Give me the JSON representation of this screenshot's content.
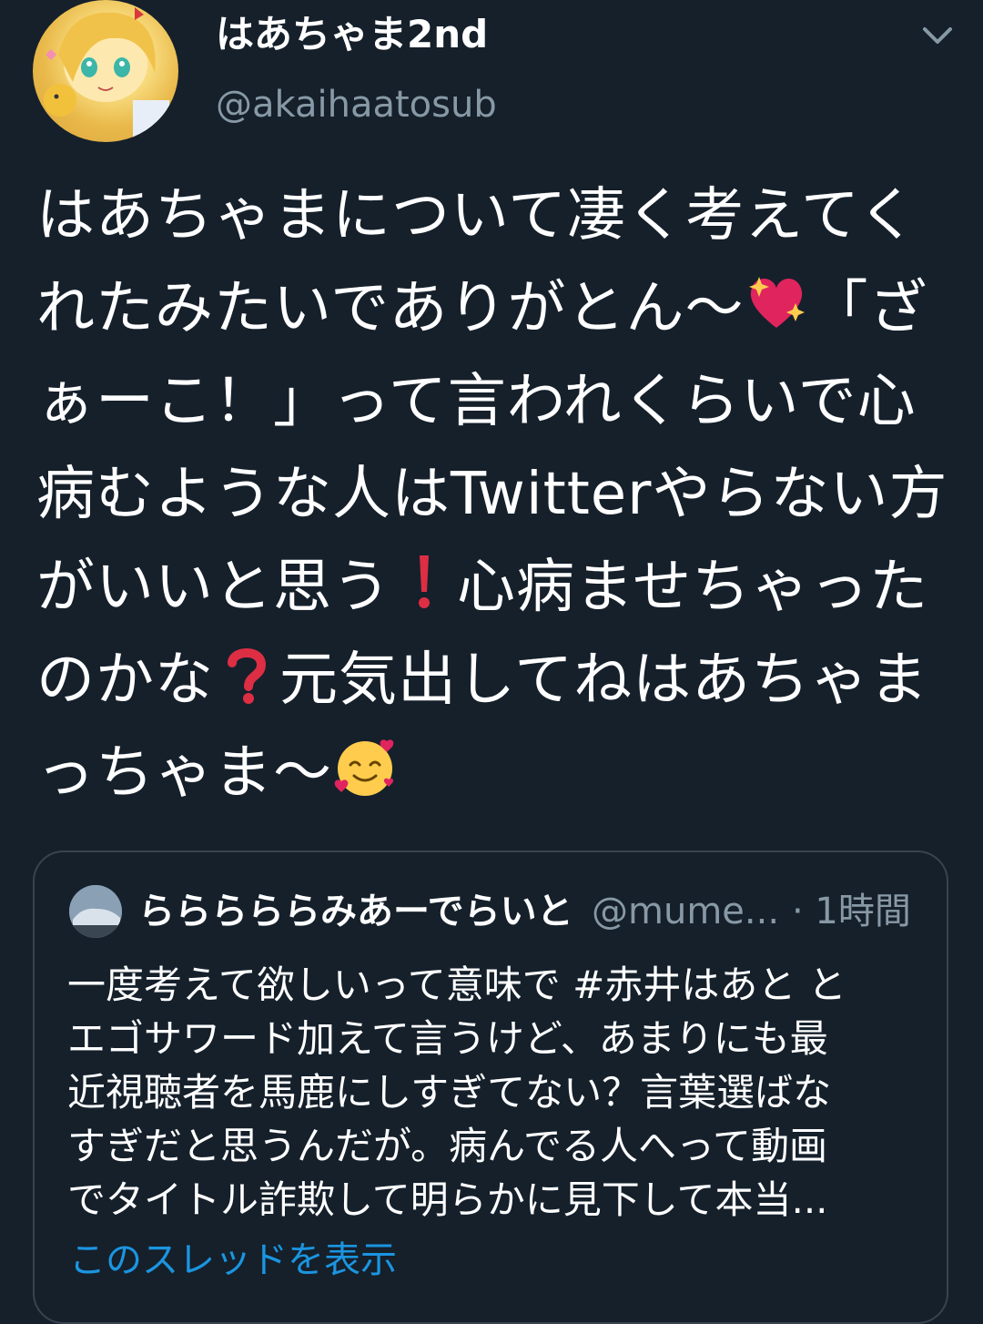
{
  "author": {
    "display_name": "はあちゃま2nd",
    "handle": "@akaihaatosub",
    "avatar_icon": "user-avatar-image"
  },
  "menu_icon": "chevron-down-icon",
  "tweet": {
    "lines": [
      "はあちゃまについて凄く考えてく",
      "れたみたいでありがとん〜",
      "「ざ",
      "ぁーこ！」って言われくらいで心",
      "病むような人はTwitterやらない方",
      "がいいと思う",
      "心病ませちゃった",
      "のかな",
      "元気出してねはあちゃま",
      "っちゃま〜"
    ],
    "emoji": {
      "sparkling_heart": "sparkling-heart-emoji",
      "exclamation": "red-exclamation-emoji",
      "question": "red-question-emoji",
      "smiling_hearts": "smiling-face-with-hearts-emoji"
    }
  },
  "quoted_tweet": {
    "display_name": "らららららみあーでらいと",
    "handle": "@mume...",
    "time": "· 1時間",
    "lines": [
      "一度考えて欲しいって意味で #赤井はあと と",
      "エゴサワード加えて言うけど、あまりにも最",
      "近視聴者を馬鹿にしすぎてない？言葉選ばな",
      "すぎだと思うんだが。病んでる人へって動画",
      "でタイトル詐欺して明らかに見下して本当..."
    ],
    "show_thread": "このスレッドを表示"
  },
  "colors": {
    "background": "#15202b",
    "text": "#ffffff",
    "secondary_text": "#8899a6",
    "border": "#38444d",
    "link": "#1b95e0"
  }
}
